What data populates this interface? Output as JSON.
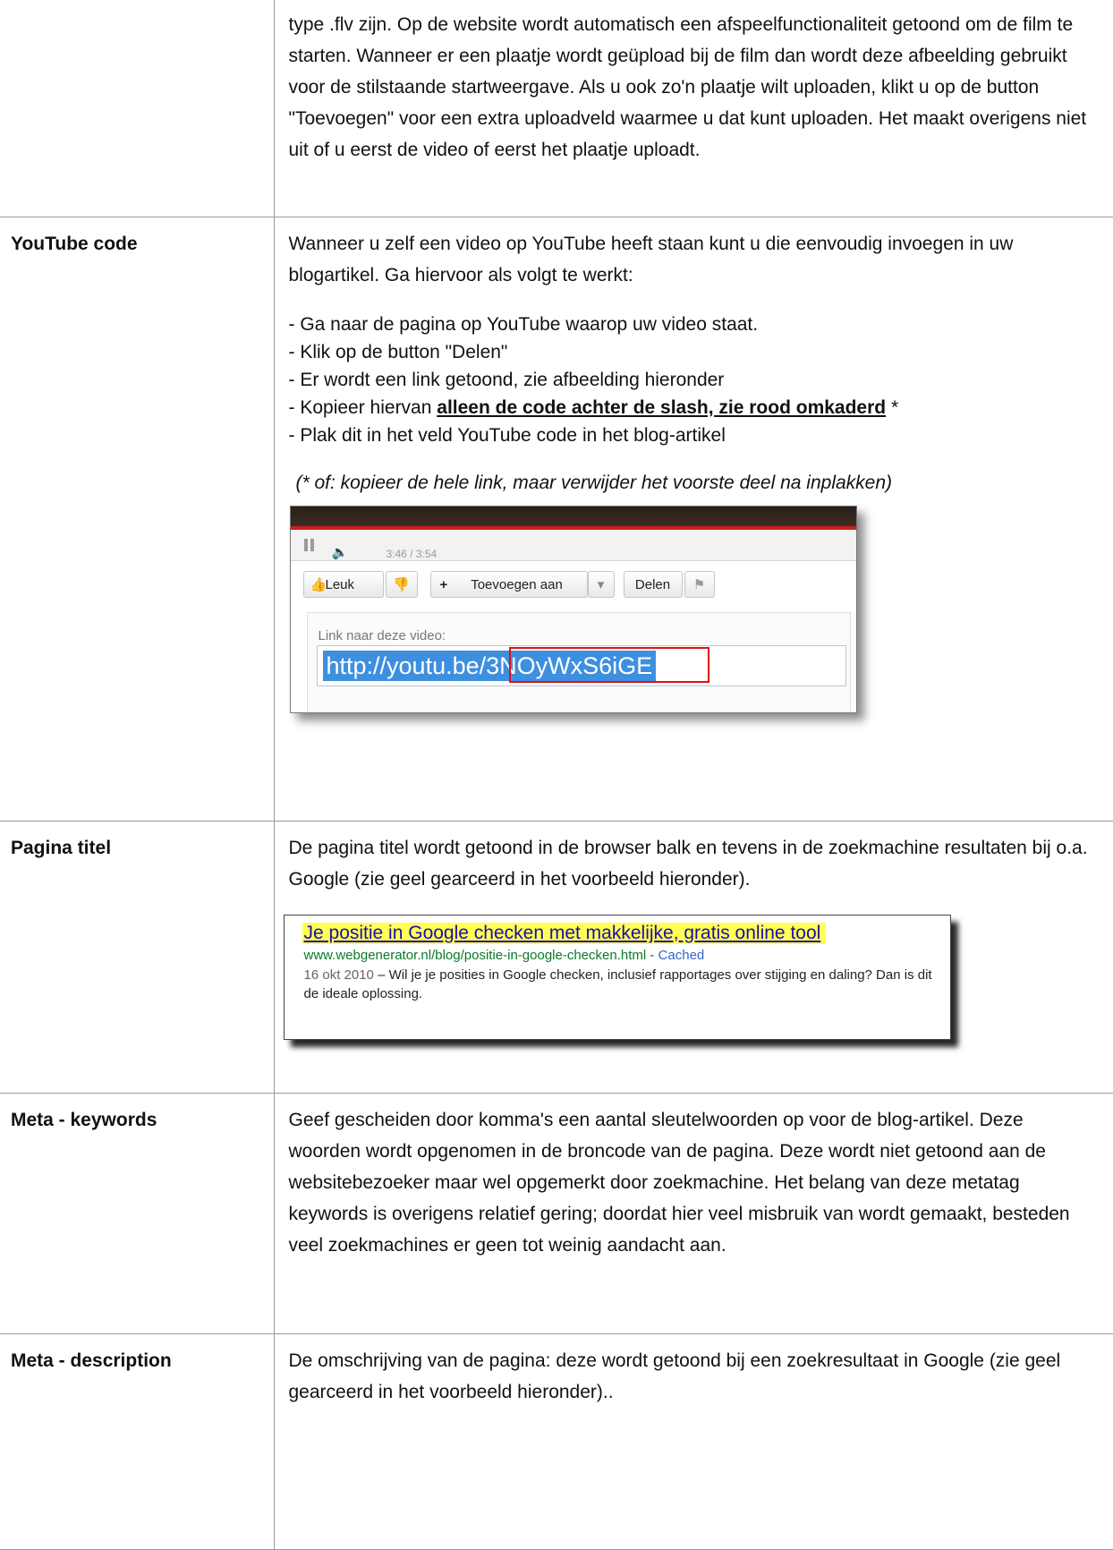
{
  "rows": [
    {
      "label": "",
      "paragraph": "type .flv zijn. Op de website wordt automatisch een afspeelfunctionaliteit getoond om de film te starten. Wanneer er een plaatje wordt geüpload bij de film dan wordt deze afbeelding gebruikt voor de stilstaande startweergave. Als u ook zo'n plaatje wilt uploaden, klikt u op de button \"Toevoegen\" voor een extra uploadveld waarmee u dat kunt uploaden. Het maakt overigens niet uit of u eerst de video of eerst het plaatje uploadt."
    },
    {
      "label": "YouTube code",
      "intro": "Wanneer u zelf een video op YouTube heeft staan kunt u die eenvoudig invoegen in uw blogartikel. Ga hiervoor als volgt te werkt:",
      "steps": [
        "- Ga naar de pagina op YouTube waarop uw video staat.",
        "- Klik op de button \"Delen\"",
        "- Er wordt een link getoond, zie afbeelding hieronder"
      ],
      "step4_prefix": "- Kopieer hiervan ",
      "step4_emphasis": "alleen de code achter de slash, zie rood omkaderd",
      "step4_suffix": " *",
      "step5": "- Plak dit in het veld YouTube code in het blog-artikel",
      "note": "(* of: kopieer de hele link, maar verwijder het voorste deel na inplakken)",
      "screenshot": {
        "time": "3:46 / 3:54",
        "like_label": "Leuk",
        "add_label": "Toevoegen aan",
        "share_label": "Delen",
        "link_label": "Link naar deze video:",
        "url_prefix": "http://youtu.be/",
        "url_code": "3NOyWxS6iGE"
      }
    },
    {
      "label": "Pagina titel",
      "paragraph": "De pagina titel wordt getoond in de browser balk en tevens in de zoekmachine resultaten bij o.a. Google (zie geel gearceerd in het voorbeeld hieronder).",
      "screenshot": {
        "title": "Je positie in Google checken met makkelijke, gratis online tool",
        "url": "www.webgenerator.nl/blog/positie-in-google-checken.html",
        "cached": "Cached",
        "date": "16 okt 2010",
        "snippet": " – Wil je je posities in Google checken, inclusief rapportages over stijging en daling? Dan is dit de ideale oplossing."
      }
    },
    {
      "label": "Meta - keywords",
      "paragraph": "Geef gescheiden door komma's een aantal sleutelwoorden op voor de blog-artikel. Deze woorden wordt opgenomen in de broncode van de pagina. Deze wordt niet getoond aan de websitebezoeker maar wel opgemerkt door zoekmachine. Het belang van deze metatag keywords is overigens relatief gering; doordat hier veel misbruik van wordt gemaakt, besteden veel zoekmachines er geen tot weinig aandacht aan."
    },
    {
      "label": "Meta - description",
      "paragraph": "De omschrijving van de pagina: deze wordt getoond bij een zoekresultaat in Google (zie geel gearceerd in het voorbeeld hieronder).."
    }
  ]
}
